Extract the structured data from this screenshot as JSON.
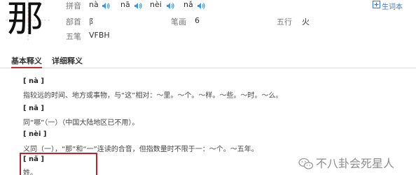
{
  "character": "那",
  "info": {
    "pinyin_label": "拼音",
    "pinyins": [
      "nà",
      "nā",
      "nèi",
      "nǎ"
    ],
    "radical_label": "部首",
    "radical": "阝",
    "strokes_label": "笔画",
    "strokes": "6",
    "five_elements_label": "五行",
    "five_elements": "火",
    "wubi_label": "五笔",
    "wubi": "VFBH"
  },
  "vocab_link": "生词本",
  "tabs": [
    "基本释义",
    "详细释义"
  ],
  "entries": [
    {
      "head": "[ nà ]",
      "text": "指较远的时间、地方或事物，与“这”相对：～里。～个。～样。～些。～时。～么。"
    },
    {
      "head": "[ nā ]",
      "text": "同“哪”（一）（中国大陆地区已不用）。"
    },
    {
      "head": "[ nèi ]",
      "text": "义同（一），“那”和“一”连读的合音，但指数量时不限于一：～个。～五年。"
    },
    {
      "head": "[ nǎ ]",
      "text": "姓。"
    }
  ],
  "watermark": "不八卦会死星人",
  "colors": {
    "accent": "#3a79c9",
    "tab_active": "#ca2a2a",
    "highlight": "#b4262d"
  }
}
